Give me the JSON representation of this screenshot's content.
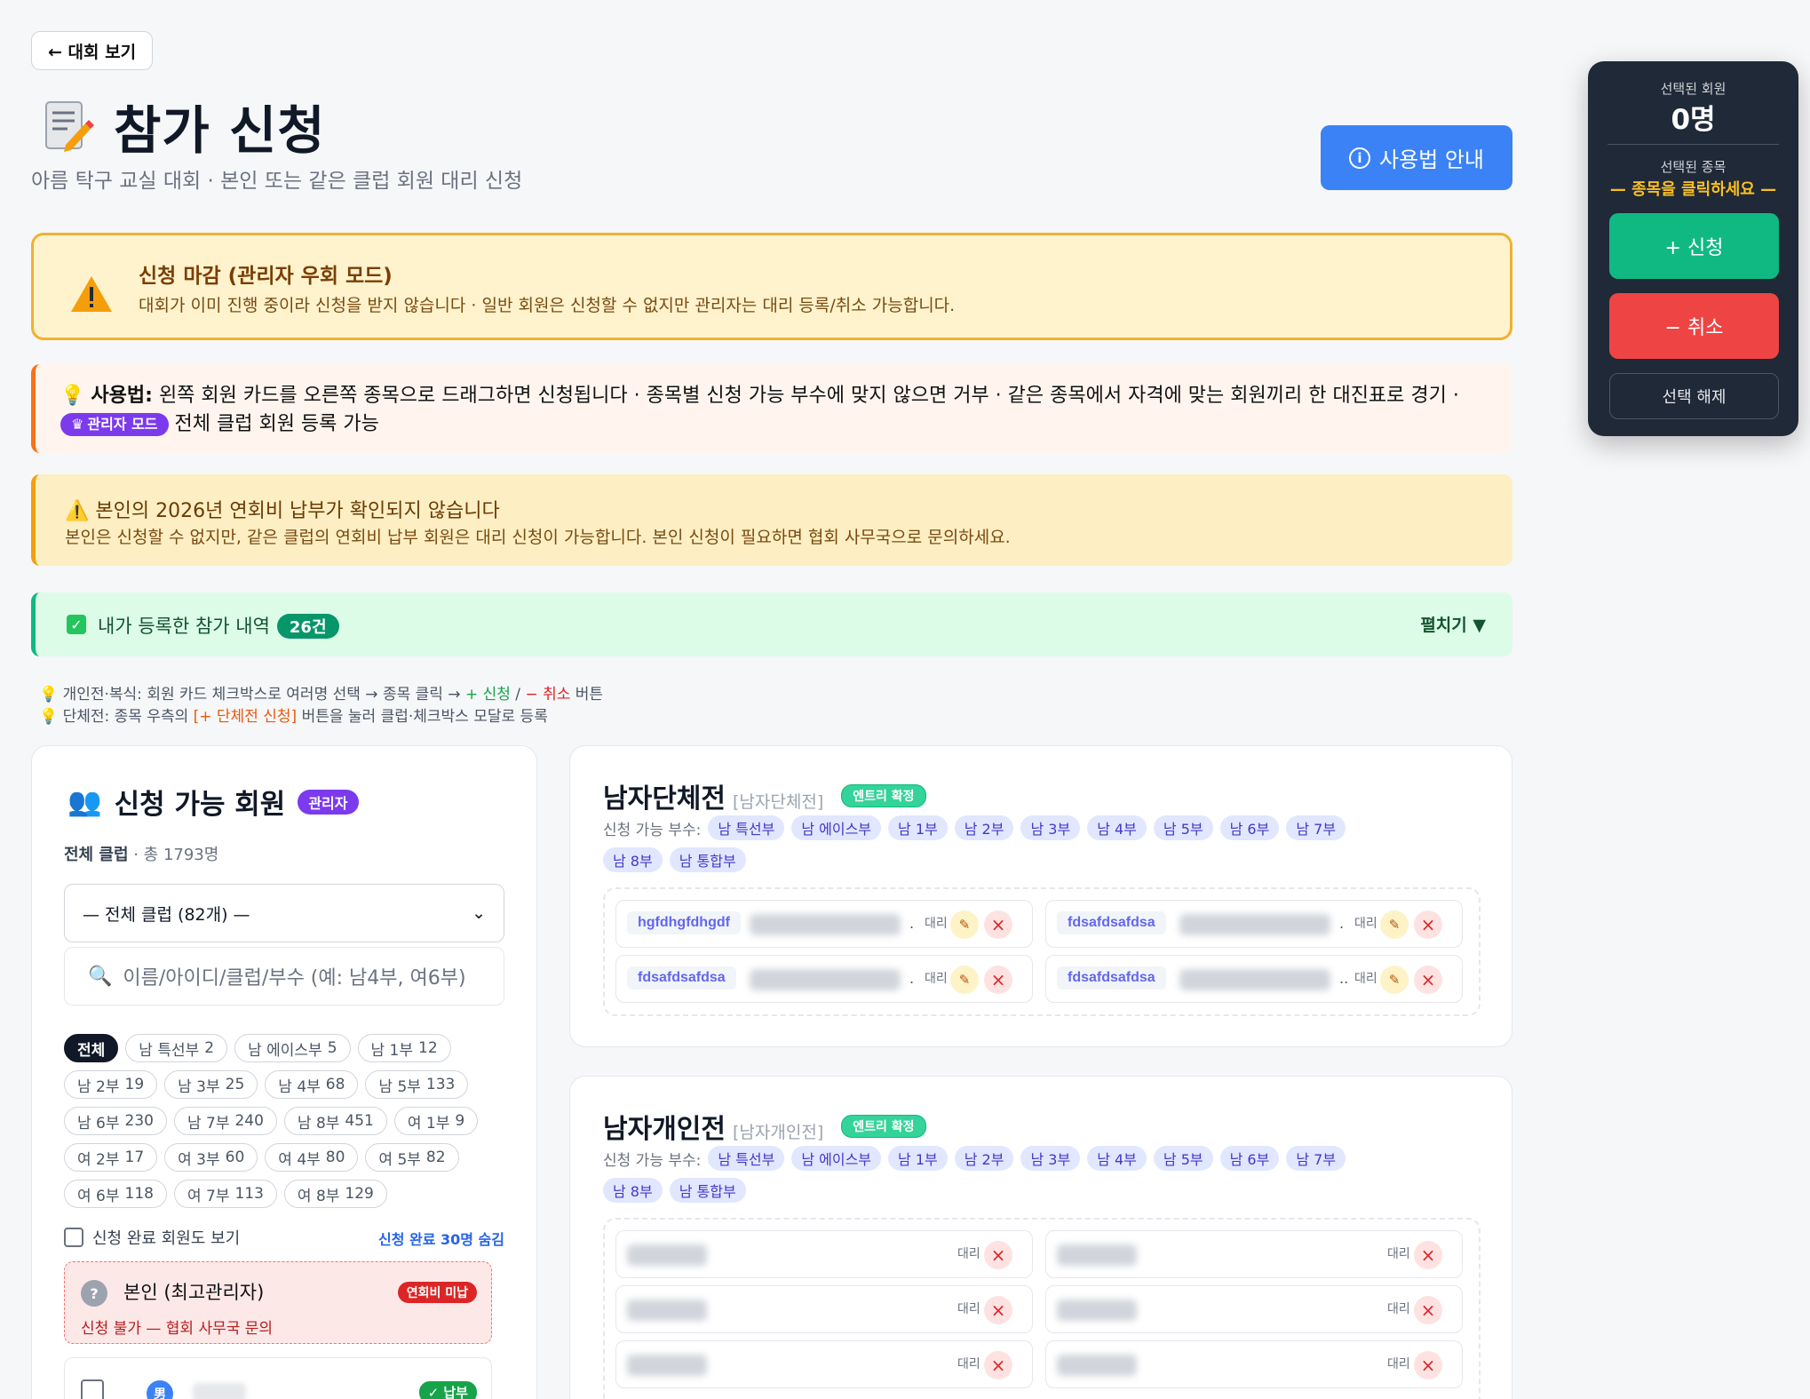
{
  "nav": {
    "back_label": "← 대회 보기"
  },
  "header": {
    "title": "참가 신청",
    "subtitle": "아름 탁구 교실 대회 · 본인 또는 같은 클럽 회원 대리 신청",
    "guide_label": "사용법 안내"
  },
  "alerts": {
    "closed": {
      "title": "신청 마감 (관리자 우회 모드)",
      "body": "대회가 이미 진행 중이라 신청을 받지 않습니다 · 일반 회원은 신청할 수 없지만 관리자는 대리 등록/취소 가능합니다."
    },
    "usage": {
      "prefix": "사용법:",
      "body": "왼쪽 회원 카드를 오른쪽 종목으로 드래그하면 신청됩니다 · 종목별 신청 가능 부수에 맞지 않으면 거부 · 같은 종목에서 자격에 맞는 회원끼리 한 대진표로 경기 ·",
      "admin_badge": "관리자 모드",
      "tail": "전체 클럽 회원 등록 가능"
    },
    "dues": {
      "title": "본인의 2026년 연회비 납부가 확인되지 않습니다",
      "body": "본인은 신청할 수 없지만, 같은 클럽의 연회비 납부 회원은 대리 신청이 가능합니다. 본인 신청이 필요하면 협회 사무국으로 문의하세요."
    },
    "mine": {
      "label": "내가 등록한 참가 내역",
      "count": "26건",
      "expand": "펼치기 ▼"
    }
  },
  "tips": {
    "line1_a": "개인전·복식: 회원 카드 체크박스로 여러명 선택 → 종목 클릭 → ",
    "line1_apply": "+ 신청",
    "line1_sep": " / ",
    "line1_cancel": "− 취소",
    "line1_end": " 버튼",
    "line2_a": "단체전: 종목 우측의 ",
    "line2_btn": "[+ 단체전 신청]",
    "line2_end": " 버튼을 눌러 클럽·체크박스 모달로 등록"
  },
  "members_panel": {
    "title": "신청 가능 회원",
    "admin_tag": "관리자",
    "scope": "전체 클럽",
    "total": " · 총 1793명",
    "club_select": "— 전체 클럽 (82개) —",
    "search_placeholder": "이름/아이디/클럽/부수 (예: 남4부, 여6부)",
    "filters": [
      {
        "label": "전체",
        "count": ""
      },
      {
        "label": "남 특선부",
        "count": "2"
      },
      {
        "label": "남 에이스부",
        "count": "5"
      },
      {
        "label": "남 1부",
        "count": "12"
      },
      {
        "label": "남 2부",
        "count": "19"
      },
      {
        "label": "남 3부",
        "count": "25"
      },
      {
        "label": "남 4부",
        "count": "68"
      },
      {
        "label": "남 5부",
        "count": "133"
      },
      {
        "label": "남 6부",
        "count": "230"
      },
      {
        "label": "남 7부",
        "count": "240"
      },
      {
        "label": "남 8부",
        "count": "451"
      },
      {
        "label": "여 1부",
        "count": "9"
      },
      {
        "label": "여 2부",
        "count": "17"
      },
      {
        "label": "여 3부",
        "count": "60"
      },
      {
        "label": "여 4부",
        "count": "80"
      },
      {
        "label": "여 5부",
        "count": "82"
      },
      {
        "label": "여 6부",
        "count": "118"
      },
      {
        "label": "여 7부",
        "count": "113"
      },
      {
        "label": "여 8부",
        "count": "129"
      }
    ],
    "show_done_label": "신청 완료 회원도 보기",
    "done_hidden": "신청 완료 30명 숨김",
    "self_card": {
      "icon": "?",
      "name": "본인 (최고관리자)",
      "badge": "연회비 미납",
      "note": "신청 불가 — 협회 사무국 문의"
    },
    "member_card": {
      "sex": "男",
      "paid": "✓ 납부"
    }
  },
  "events": [
    {
      "name": "남자단체전",
      "code": "[남자단체전]",
      "status": "엔트리 확정",
      "divisions_label": "신청 가능 부수:",
      "divisions": [
        "남 특선부",
        "남 에이스부",
        "남 1부",
        "남 2부",
        "남 3부",
        "남 4부",
        "남 5부",
        "남 6부",
        "남 7부",
        "남 8부",
        "남 통합부"
      ],
      "entries": [
        {
          "name": "hgfdhgfdhgdf",
          "proxy": "대리"
        },
        {
          "name": "fdsafdsafdsa",
          "proxy": "대리"
        },
        {
          "name": "fdsafdsafdsa",
          "proxy": "대리"
        },
        {
          "name": "fdsafdsafdsa",
          "proxy": "대리"
        }
      ]
    },
    {
      "name": "남자개인전",
      "code": "[남자개인전]",
      "status": "엔트리 확정",
      "divisions_label": "신청 가능 부수:",
      "divisions": [
        "남 특선부",
        "남 에이스부",
        "남 1부",
        "남 2부",
        "남 3부",
        "남 4부",
        "남 5부",
        "남 6부",
        "남 7부",
        "남 8부",
        "남 통합부"
      ],
      "entries": [
        {
          "proxy": "대리"
        },
        {
          "proxy": "대리"
        },
        {
          "proxy": "대리"
        },
        {
          "proxy": "대리"
        },
        {
          "proxy": "대리"
        },
        {
          "proxy": "대리"
        }
      ]
    }
  ],
  "side_panel": {
    "selected_members_label": "선택된 회원",
    "selected_count": "0명",
    "selected_event_label": "선택된 종목",
    "selected_event": "— 종목을 클릭하세요 —",
    "apply_label": "+ 신청",
    "cancel_label": "− 취소",
    "clear_label": "선택 해제"
  },
  "colors": {
    "accent_blue": "#3b82f6",
    "apply_green": "#10b981",
    "cancel_red": "#ef4444",
    "admin_purple": "#7c3aed"
  }
}
